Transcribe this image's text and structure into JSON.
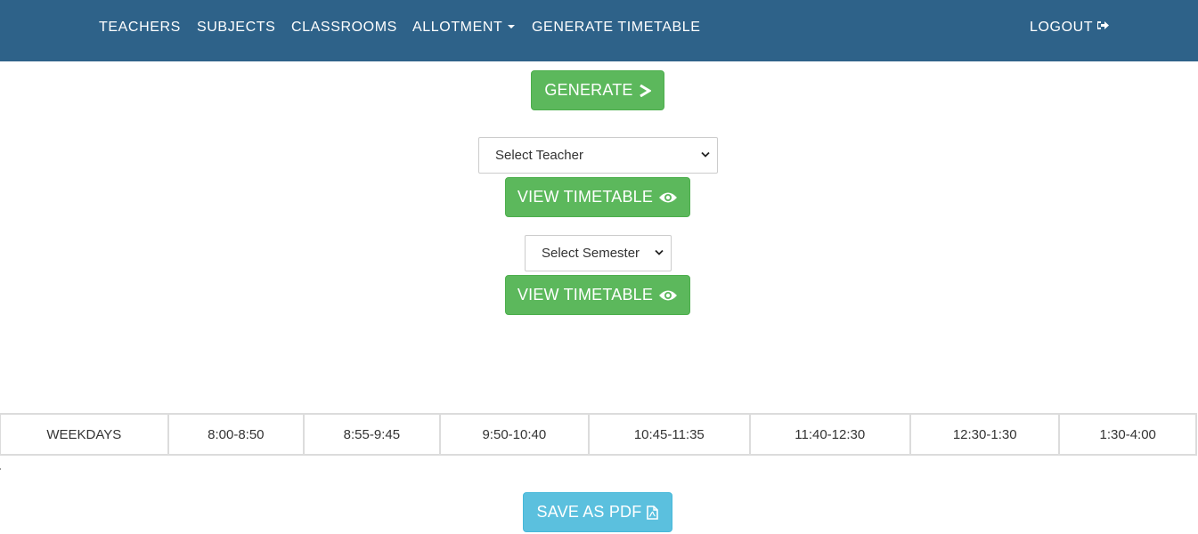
{
  "navbar": {
    "items": [
      {
        "label": "TEACHERS"
      },
      {
        "label": "SUBJECTS"
      },
      {
        "label": "CLASSROOMS"
      },
      {
        "label": "ALLOTMENT"
      },
      {
        "label": "GENERATE TIMETABLE"
      }
    ],
    "logout_label": "LOGOUT",
    "background": "#2e6289"
  },
  "generate_button": {
    "label": "GENERATE",
    "icon": "chevron-right-icon"
  },
  "teacher_section": {
    "select_value": "Select Teacher",
    "view_button": {
      "label": "VIEW TIMETABLE",
      "icon": "eye-icon"
    }
  },
  "semester_section": {
    "select_value": "Select Semester",
    "view_button": {
      "label": "VIEW TIMETABLE",
      "icon": "eye-icon"
    }
  },
  "timetable": {
    "headers": [
      "WEEKDAYS",
      "8:00-8:50",
      "8:55-9:45",
      "9:50-10:40",
      "10:45-11:35",
      "11:40-12:30",
      "12:30-1:30",
      "1:30-4:00"
    ]
  },
  "save_pdf_button": {
    "label": "SAVE AS PDF",
    "icon": "pdf-file-icon"
  },
  "colors": {
    "success": "#5cb85c",
    "info": "#5bc0de"
  }
}
